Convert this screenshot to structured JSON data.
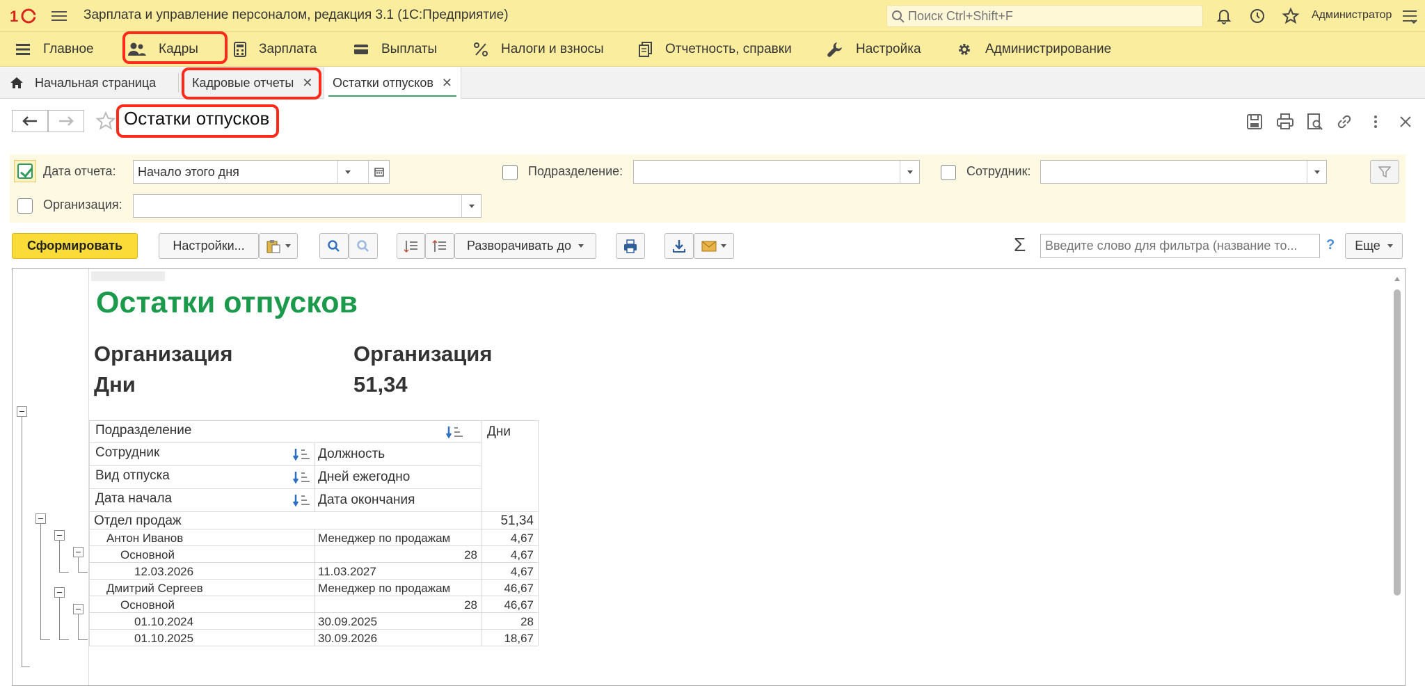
{
  "app": {
    "title": "Зарплата и управление персоналом, редакция 3.1  (1С:Предприятие)",
    "logo": "1С",
    "search_placeholder": "Поиск Ctrl+Shift+F",
    "user": "Администратор"
  },
  "sections": [
    {
      "label": "Главное",
      "icon": "menu-icon"
    },
    {
      "label": "Кадры",
      "icon": "people-icon"
    },
    {
      "label": "Зарплата",
      "icon": "calculator-icon"
    },
    {
      "label": "Выплаты",
      "icon": "wallet-icon"
    },
    {
      "label": "Налоги и взносы",
      "icon": "percent-icon"
    },
    {
      "label": "Отчетность, справки",
      "icon": "documents-icon"
    },
    {
      "label": "Настройка",
      "icon": "wrench-icon"
    },
    {
      "label": "Администрирование",
      "icon": "gear-icon"
    }
  ],
  "tabs": [
    {
      "label": "Начальная страница",
      "icon": "home-icon"
    },
    {
      "label": "Кадровые отчеты"
    },
    {
      "label": "Остатки отпусков",
      "active": true
    }
  ],
  "form": {
    "title": "Остатки отпусков"
  },
  "params": {
    "report_date_label": "Дата отчета:",
    "report_date_value": "Начало этого дня",
    "department_label": "Подразделение:",
    "employee_label": "Сотрудник:",
    "organization_label": "Организация:"
  },
  "toolbar": {
    "generate": "Сформировать",
    "settings": "Настройки...",
    "expand_to": "Разворачивать до",
    "filter_placeholder": "Введите слово для фильтра (название то...",
    "help": "?",
    "more": "Еще"
  },
  "report": {
    "title": "Остатки отпусков",
    "summary": [
      {
        "left": "Организация",
        "right": "Организация"
      },
      {
        "left": "Дни",
        "right": "51,34"
      }
    ],
    "header": {
      "department": "Подразделение",
      "employee": "Сотрудник",
      "position": "Должность",
      "leave_type": "Вид отпуска",
      "days_per_year": "Дней ежегодно",
      "start_date": "Дата начала",
      "end_date": "Дата окончания",
      "days": "Дни"
    },
    "rows": [
      {
        "c1": "Отдел продаж",
        "c2": "",
        "c3": "51,34"
      },
      {
        "c1": "Антон Иванов",
        "c2": "Менеджер по продажам",
        "c3": "4,67"
      },
      {
        "c1": "Основной",
        "c2": "28",
        "c3": "4,67"
      },
      {
        "c1": "12.03.2026",
        "c2": "11.03.2027",
        "c3": "4,67"
      },
      {
        "c1": "Дмитрий Сергеев",
        "c2": "Менеджер по продажам",
        "c3": "46,67"
      },
      {
        "c1": "Основной",
        "c2": "28",
        "c3": "46,67"
      },
      {
        "c1": "01.10.2024",
        "c2": "30.09.2025",
        "c3": "28"
      },
      {
        "c1": "01.10.2025",
        "c2": "30.09.2026",
        "c3": "18,67"
      }
    ]
  },
  "colors": {
    "accent_yellow": "#fbed9e",
    "title_green": "#1a9a4a",
    "highlight": "#ff2a1a",
    "primary_button": "#fbdb38"
  }
}
